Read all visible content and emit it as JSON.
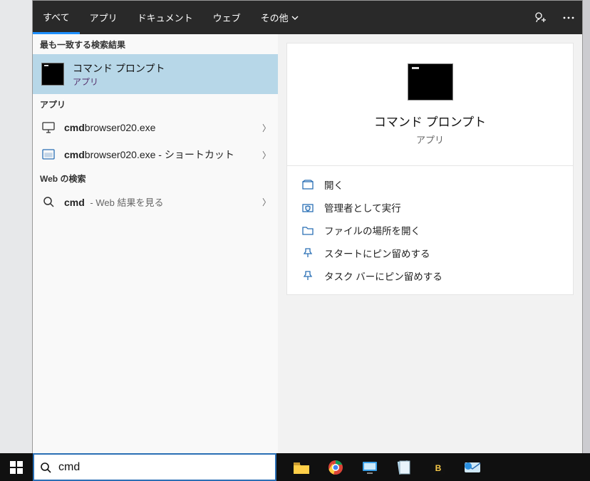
{
  "tabs": {
    "all": "すべて",
    "apps": "アプリ",
    "documents": "ドキュメント",
    "web": "ウェブ",
    "more": "その他"
  },
  "sections": {
    "best_match": "最も一致する検索結果",
    "apps": "アプリ",
    "web": "Web の検索"
  },
  "best": {
    "title": "コマンド プロンプト",
    "category": "アプリ"
  },
  "app_rows": [
    {
      "bold": "cmd",
      "rest": "browser020.exe"
    },
    {
      "bold": "cmd",
      "rest": "browser020.exe - ショートカット"
    }
  ],
  "web_row": {
    "bold": "cmd",
    "suffix": " - Web 結果を見る"
  },
  "preview": {
    "title": "コマンド プロンプト",
    "category": "アプリ",
    "actions": {
      "open": "開く",
      "admin": "管理者として実行",
      "open_location": "ファイルの場所を開く",
      "pin_start": "スタートにピン留めする",
      "pin_taskbar": "タスク バーにピン留めする"
    }
  },
  "search_value": "cmd"
}
